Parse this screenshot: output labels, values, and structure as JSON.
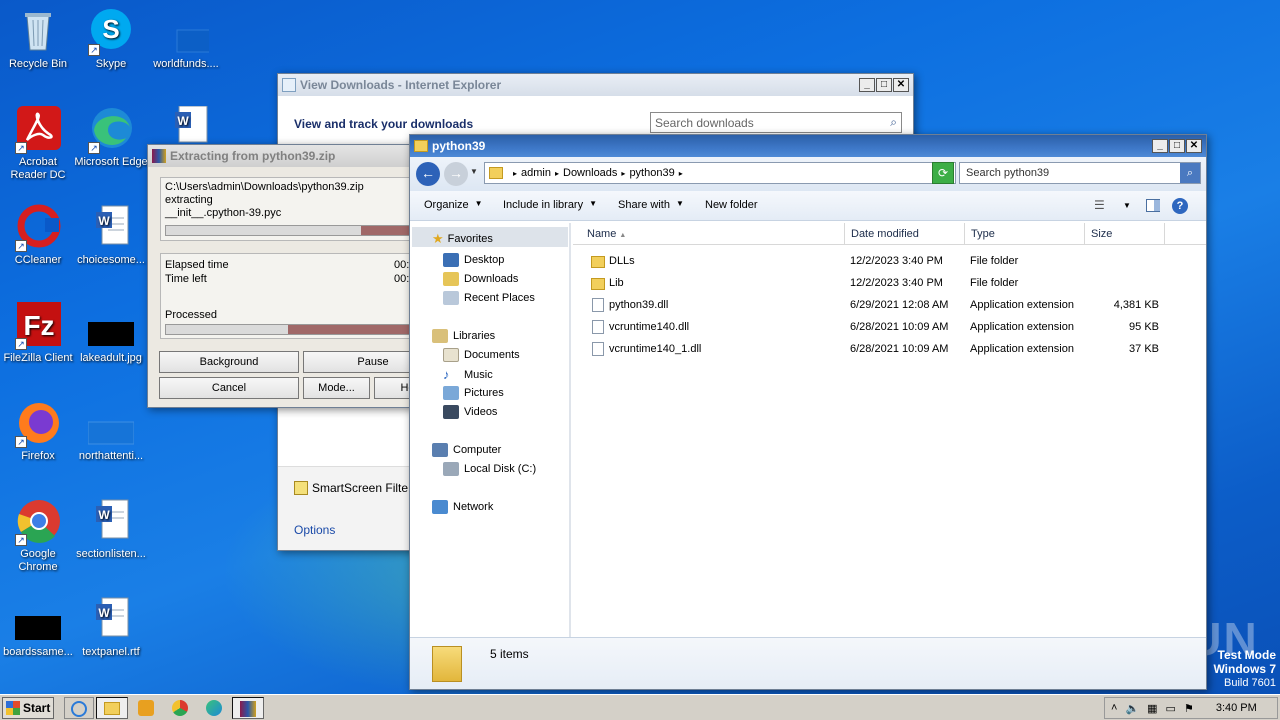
{
  "desktop": {
    "icons": [
      {
        "label": "Recycle Bin"
      },
      {
        "label": "Skype"
      },
      {
        "label": "worldfunds...."
      },
      {
        "label": "Acrobat Reader DC"
      },
      {
        "label": "Microsoft Edge"
      },
      {
        "label": "CCleaner"
      },
      {
        "label": "choicesome..."
      },
      {
        "label": "FileZilla Client"
      },
      {
        "label": "lakeadult.jpg"
      },
      {
        "label": "Firefox"
      },
      {
        "label": "northattenti..."
      },
      {
        "label": "Google Chrome"
      },
      {
        "label": "sectionlisten..."
      },
      {
        "label": "boardssame..."
      },
      {
        "label": "textpanel.rtf"
      }
    ],
    "watermark": {
      "text": "ANY RUN",
      "mode": "Test Mode",
      "os": "Windows 7",
      "build": "Build 7601"
    }
  },
  "ie_window": {
    "title": "View Downloads - Internet Explorer",
    "heading": "View and track your downloads",
    "search_placeholder": "Search downloads",
    "smartscreen": "SmartScreen Filte",
    "options": "Options"
  },
  "extract_window": {
    "title": "Extracting from python39.zip",
    "path": "C:\\Users\\admin\\Downloads\\python39.zip",
    "action": "extracting",
    "file": "__init__.cpython-39.pyc",
    "elapsed_label": "Elapsed time",
    "elapsed_value": "00:",
    "left_label": "Time left",
    "left_value": "00:",
    "processed_label": "Processed",
    "progress_file": 0.8,
    "progress_total": 0.5,
    "buttons": {
      "background": "Background",
      "pause": "Pause",
      "cancel": "Cancel",
      "mode": "Mode...",
      "help": "He"
    }
  },
  "explorer": {
    "title": "python39",
    "breadcrumb": [
      "admin",
      "Downloads",
      "python39"
    ],
    "search_placeholder": "Search python39",
    "toolbar": {
      "organize": "Organize",
      "include": "Include in library",
      "share": "Share with",
      "new_folder": "New folder"
    },
    "nav": {
      "favorites": "Favorites",
      "desktop": "Desktop",
      "downloads": "Downloads",
      "recent": "Recent Places",
      "libraries": "Libraries",
      "documents": "Documents",
      "music": "Music",
      "pictures": "Pictures",
      "videos": "Videos",
      "computer": "Computer",
      "localdisk": "Local Disk (C:)",
      "network": "Network"
    },
    "columns": {
      "name": "Name",
      "date": "Date modified",
      "type": "Type",
      "size": "Size"
    },
    "files": [
      {
        "name": "DLLs",
        "date": "12/2/2023 3:40 PM",
        "type": "File folder",
        "size": ""
      },
      {
        "name": "Lib",
        "date": "12/2/2023 3:40 PM",
        "type": "File folder",
        "size": ""
      },
      {
        "name": "python39.dll",
        "date": "6/29/2021 12:08 AM",
        "type": "Application extension",
        "size": "4,381 KB"
      },
      {
        "name": "vcruntime140.dll",
        "date": "6/28/2021 10:09 AM",
        "type": "Application extension",
        "size": "95 KB"
      },
      {
        "name": "vcruntime140_1.dll",
        "date": "6/28/2021 10:09 AM",
        "type": "Application extension",
        "size": "37 KB"
      }
    ],
    "status": "5 items"
  },
  "taskbar": {
    "start": "Start",
    "clock": "3:40 PM"
  }
}
